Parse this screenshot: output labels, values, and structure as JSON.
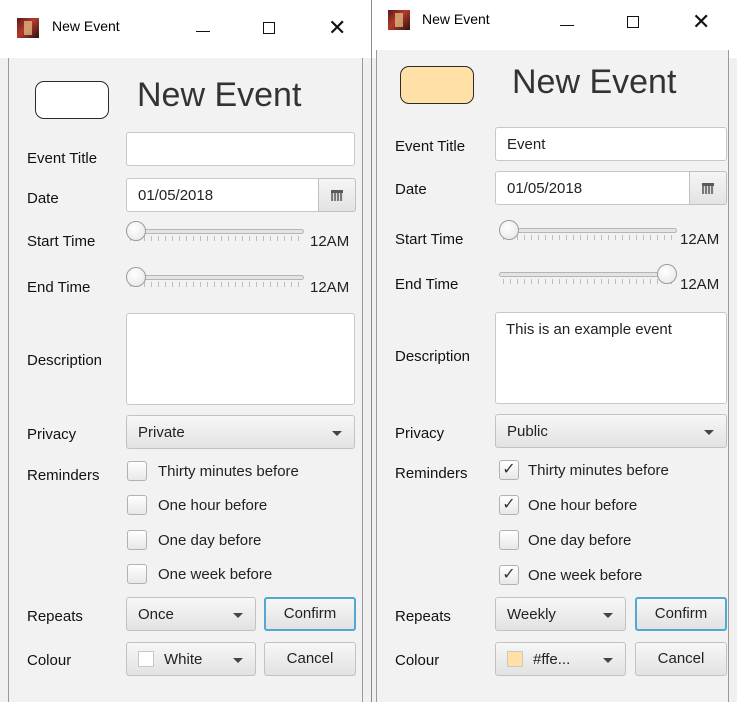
{
  "left": {
    "window_title": "New Event",
    "heading": "New Event",
    "colour_preview": "#ffffff",
    "labels": {
      "event_title": "Event Title",
      "date": "Date",
      "start_time": "Start Time",
      "end_time": "End Time",
      "description": "Description",
      "privacy": "Privacy",
      "reminders": "Reminders",
      "repeats": "Repeats",
      "colour": "Colour"
    },
    "event_title_value": "",
    "date_value": "01/05/2018",
    "start_time_text": "12AM",
    "start_time_level": 0,
    "end_time_text": "12AM",
    "end_time_level": 0,
    "description_value": "",
    "privacy_value": "Private",
    "reminders": [
      {
        "label": "Thirty minutes before",
        "checked": false
      },
      {
        "label": "One hour before",
        "checked": false
      },
      {
        "label": "One day before",
        "checked": false
      },
      {
        "label": "One week before",
        "checked": false
      }
    ],
    "repeats_value": "Once",
    "confirm_label": "Confirm",
    "colour_value": "White",
    "colour_swatch": "#ffffff",
    "cancel_label": "Cancel"
  },
  "right": {
    "window_title": "New Event",
    "heading": "New Event",
    "colour_preview": "#ffe0a6",
    "labels": {
      "event_title": "Event Title",
      "date": "Date",
      "start_time": "Start Time",
      "end_time": "End Time",
      "description": "Description",
      "privacy": "Privacy",
      "reminders": "Reminders",
      "repeats": "Repeats",
      "colour": "Colour"
    },
    "event_title_value": "Event",
    "date_value": "01/05/2018",
    "start_time_text": "12AM",
    "start_time_level": 0,
    "end_time_text": "12AM",
    "end_time_level": 1,
    "description_value": "This is an example event",
    "privacy_value": "Public",
    "reminders": [
      {
        "label": "Thirty minutes before",
        "checked": true
      },
      {
        "label": "One hour before",
        "checked": true
      },
      {
        "label": "One day before",
        "checked": false
      },
      {
        "label": "One week before",
        "checked": true
      }
    ],
    "repeats_value": "Weekly",
    "confirm_label": "Confirm",
    "colour_value": "#ffe...",
    "colour_swatch": "#ffe0a6",
    "cancel_label": "Cancel"
  },
  "icons": {
    "check": "✓",
    "close": "✕"
  }
}
